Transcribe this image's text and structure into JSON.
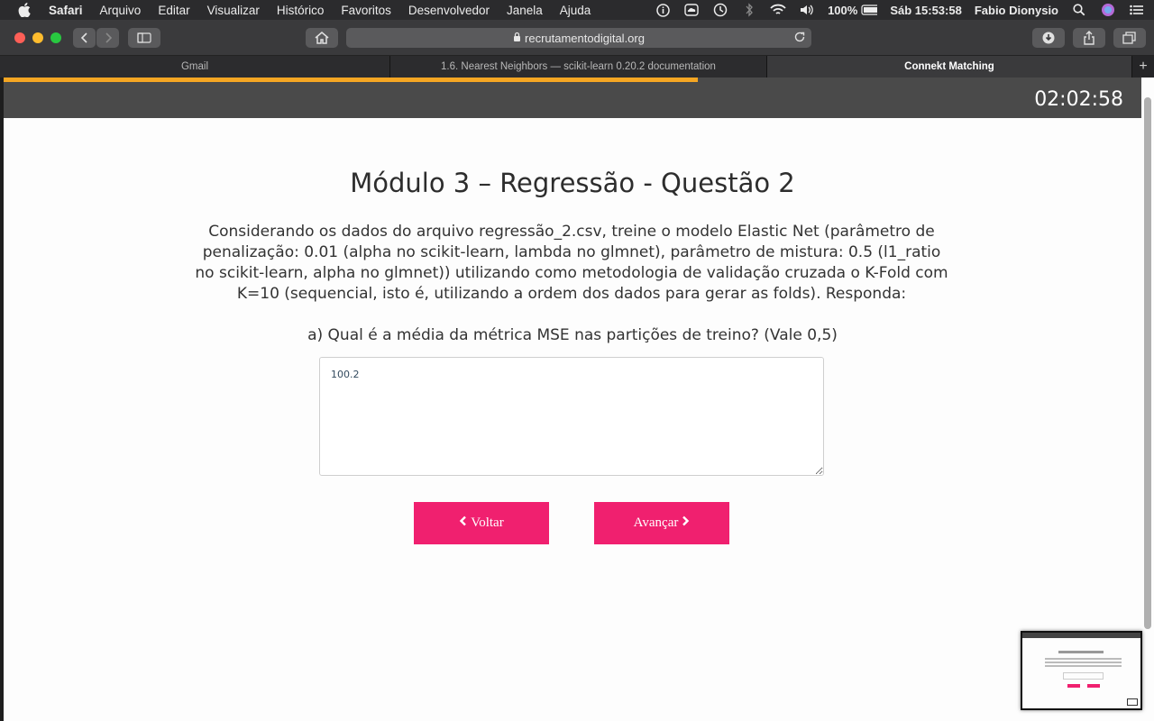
{
  "menubar": {
    "app": "Safari",
    "items": [
      "Arquivo",
      "Editar",
      "Visualizar",
      "Histórico",
      "Favoritos",
      "Desenvolvedor",
      "Janela",
      "Ajuda"
    ],
    "battery": "100%",
    "clock": "Sáb 15:53:58",
    "user": "Fabio Dionysio"
  },
  "toolbar": {
    "url": "recrutamentodigital.org"
  },
  "tabs": [
    {
      "label": "Gmail"
    },
    {
      "label": "1.6. Nearest Neighbors — scikit-learn 0.20.2 documentation"
    },
    {
      "label": "Connekt Matching"
    }
  ],
  "page": {
    "timer": "02:02:58",
    "progress": 0.61,
    "title": "Módulo 3 – Regressão - Questão 2",
    "question": "Considerando os dados do arquivo regressão_2.csv, treine o modelo Elastic Net (parâmetro de penalização: 0.01 (alpha no scikit-learn, lambda no glmnet), parâmetro de mistura: 0.5 (l1_ratio no scikit-learn, alpha no glmnet)) utilizando como metodologia de validação cruzada o K-Fold com K=10 (sequencial, isto é, utilizando a ordem dos dados para gerar as folds). Responda:",
    "subquestion": "a) Qual é a média da métrica MSE nas partições de treino? (Vale 0,5)",
    "answer": "100.2",
    "back_label": "Voltar",
    "next_label": "Avançar"
  },
  "colors": {
    "accent": "#f0206f",
    "progress": "#f5a623",
    "header": "#4a4a4a"
  }
}
